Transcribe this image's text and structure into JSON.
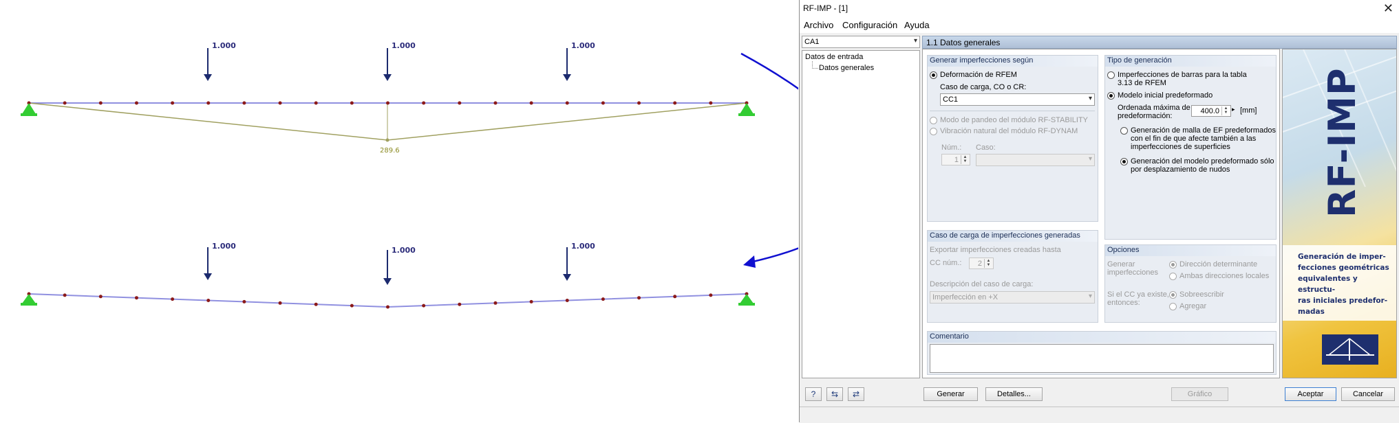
{
  "drawing": {
    "load_labels_top": [
      "1.000",
      "1.000",
      "1.000"
    ],
    "load_labels_bottom": [
      "1.000",
      "1.000",
      "1.000"
    ],
    "deflection_label": "289.6",
    "colors": {
      "beam": "#9090e0",
      "node": "#8b1a1a",
      "support": "#33cc33",
      "load": "#1c2a6e",
      "deflection": "#a0a060",
      "arrow": "#1010d0"
    }
  },
  "window": {
    "title": "RF-IMP - [1]",
    "close_glyph": "✕",
    "menu": [
      "Archivo",
      "Configuración",
      "Ayuda"
    ],
    "nav_combo_value": "CA1",
    "nav_tree": {
      "root": "Datos de entrada",
      "child": "Datos generales"
    },
    "section_header": "1.1 Datos generales",
    "gen_imperf": {
      "title": "Generar imperfecciones según",
      "opt_rfem": "Deformación de RFEM",
      "caso_label": "Caso de carga, CO o CR:",
      "caso_value": "CC1",
      "opt_stability": "Modo de pandeo del módulo RF-STABILITY",
      "opt_dynam": "Vibración natural del módulo RF-DYNAM",
      "num_label": "Núm.:",
      "caso2_label": "Caso:",
      "num_value": "1"
    },
    "tipo_gen": {
      "title": "Tipo de generación",
      "opt_table": "Imperfecciones de barras para la tabla 3.13 de RFEM",
      "opt_table_l1": "Imperfecciones de barras para la tabla",
      "opt_table_l2": "3.13 de RFEM",
      "opt_modelo": "Modelo inicial predeformado",
      "ord_label_l1": "Ordenada máxima de",
      "ord_label_l2": "predeformación:",
      "ord_value": "400.0",
      "ord_unit": "[mm]",
      "opt_malla_l1": "Generación de malla de EF predeformados",
      "opt_malla_l2": "con el fin de que afecte también a las",
      "opt_malla_l3": "imperfecciones de superficies",
      "opt_nudos_l1": "Generación del modelo predeformado sólo",
      "opt_nudos_l2": "por desplazamiento de nudos"
    },
    "caso_carga": {
      "title": "Caso de carga de imperfecciones generadas",
      "export_label": "Exportar imperfecciones creadas hasta",
      "cc_label": "CC núm.:",
      "cc_value": "2",
      "desc_label": "Descripción del caso de carga:",
      "desc_value": "Imperfección en +X"
    },
    "opciones": {
      "title": "Opciones",
      "generar_l1": "Generar",
      "generar_l2": "imperfecciones",
      "opt_dir": "Dirección determinante",
      "opt_ambas": "Ambas direcciones locales",
      "si_l1": "Si el CC ya existe,",
      "si_l2": "entonces:",
      "opt_sobre": "Sobreescribir",
      "opt_agregar": "Agregar"
    },
    "comentario": {
      "title": "Comentario",
      "value": ""
    },
    "banner": {
      "word": "RF-IMP",
      "text_lines": [
        "Generación de imper-",
        "fecciones geométricas",
        "equivalentes y estructu-",
        "ras iniciales predefor-",
        "madas"
      ]
    },
    "buttons": {
      "generar": "Generar",
      "detalles": "Detalles...",
      "grafico": "Gráfico",
      "aceptar": "Aceptar",
      "cancelar": "Cancelar",
      "help_glyph": "?",
      "icon2_glyph": "⇆",
      "icon3_glyph": "⇄"
    }
  }
}
